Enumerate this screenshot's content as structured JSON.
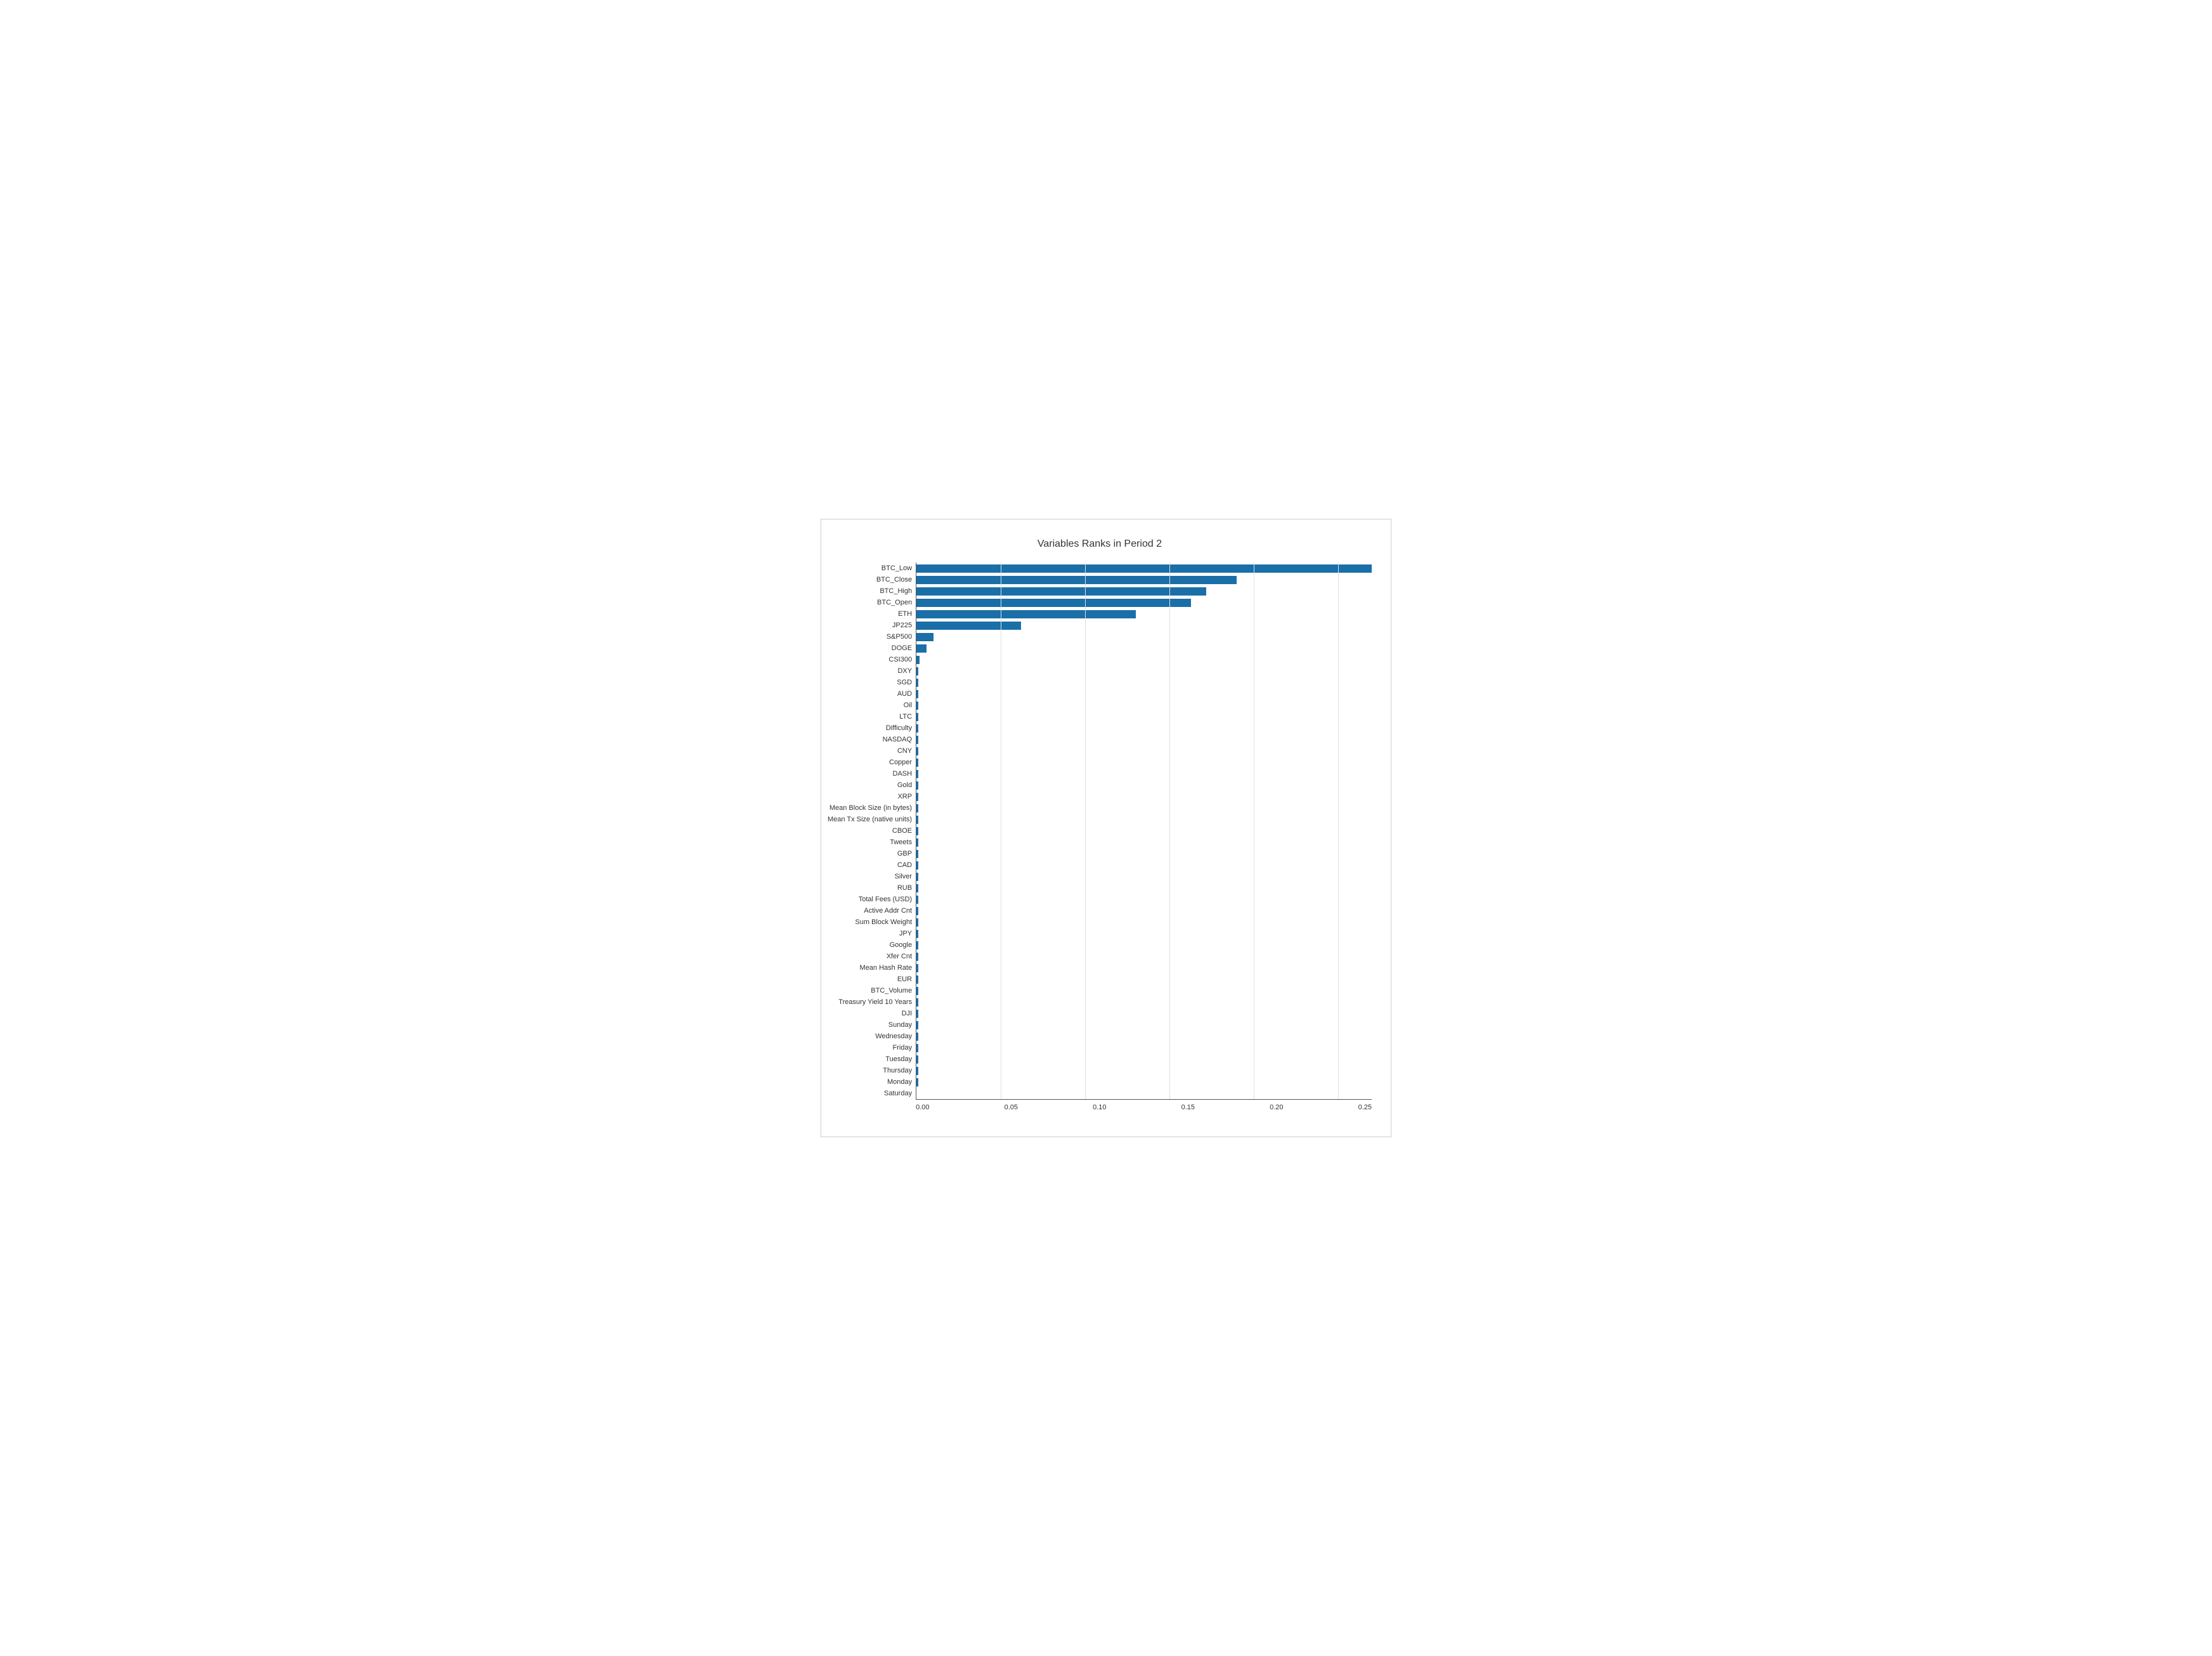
{
  "chart": {
    "title": "Variables Ranks in Period 2",
    "bar_color": "#1a6fa8",
    "max_value": 0.27,
    "x_ticks": [
      "0.00",
      "0.05",
      "0.10",
      "0.15",
      "0.20",
      "0.25"
    ],
    "bars": [
      {
        "label": "BTC_Low",
        "value": 0.27
      },
      {
        "label": "BTC_Close",
        "value": 0.19
      },
      {
        "label": "BTC_High",
        "value": 0.172
      },
      {
        "label": "BTC_Open",
        "value": 0.163
      },
      {
        "label": "ETH",
        "value": 0.13
      },
      {
        "label": "JP225",
        "value": 0.062
      },
      {
        "label": "S&P500",
        "value": 0.01
      },
      {
        "label": "DOGE",
        "value": 0.006
      },
      {
        "label": "CSI300",
        "value": 0.002
      },
      {
        "label": "DXY",
        "value": 0.001
      },
      {
        "label": "SGD",
        "value": 0.001
      },
      {
        "label": "AUD",
        "value": 0.001
      },
      {
        "label": "Oil",
        "value": 0.001
      },
      {
        "label": "LTC",
        "value": 0.001
      },
      {
        "label": "Difficulty",
        "value": 0.001
      },
      {
        "label": "NASDAQ",
        "value": 0.001
      },
      {
        "label": "CNY",
        "value": 0.001
      },
      {
        "label": "Copper",
        "value": 0.001
      },
      {
        "label": "DASH",
        "value": 0.001
      },
      {
        "label": "Gold",
        "value": 0.001
      },
      {
        "label": "XRP",
        "value": 0.001
      },
      {
        "label": "Mean Block Size (in bytes)",
        "value": 0.001
      },
      {
        "label": "Mean Tx Size (native units)",
        "value": 0.001
      },
      {
        "label": "CBOE",
        "value": 0.001
      },
      {
        "label": "Tweets",
        "value": 0.001
      },
      {
        "label": "GBP",
        "value": 0.001
      },
      {
        "label": "CAD",
        "value": 0.001
      },
      {
        "label": "Silver",
        "value": 0.001
      },
      {
        "label": "RUB",
        "value": 0.001
      },
      {
        "label": "Total Fees (USD)",
        "value": 0.001
      },
      {
        "label": "Active Addr Cnt",
        "value": 0.001
      },
      {
        "label": "Sum Block Weight",
        "value": 0.001
      },
      {
        "label": "JPY",
        "value": 0.001
      },
      {
        "label": "Google",
        "value": 0.001
      },
      {
        "label": "Xfer Cnt",
        "value": 0.001
      },
      {
        "label": "Mean Hash Rate",
        "value": 0.001
      },
      {
        "label": "EUR",
        "value": 0.001
      },
      {
        "label": "BTC_Volume",
        "value": 0.001
      },
      {
        "label": "Treasury Yield 10 Years",
        "value": 0.001
      },
      {
        "label": "DJI",
        "value": 0.001
      },
      {
        "label": "Sunday",
        "value": 0.001
      },
      {
        "label": "Wednesday",
        "value": 0.001
      },
      {
        "label": "Friday",
        "value": 0.001
      },
      {
        "label": "Tuesday",
        "value": 0.001
      },
      {
        "label": "Thursday",
        "value": 0.001
      },
      {
        "label": "Monday",
        "value": 0.001
      },
      {
        "label": "Saturday",
        "value": 0.0
      }
    ]
  }
}
